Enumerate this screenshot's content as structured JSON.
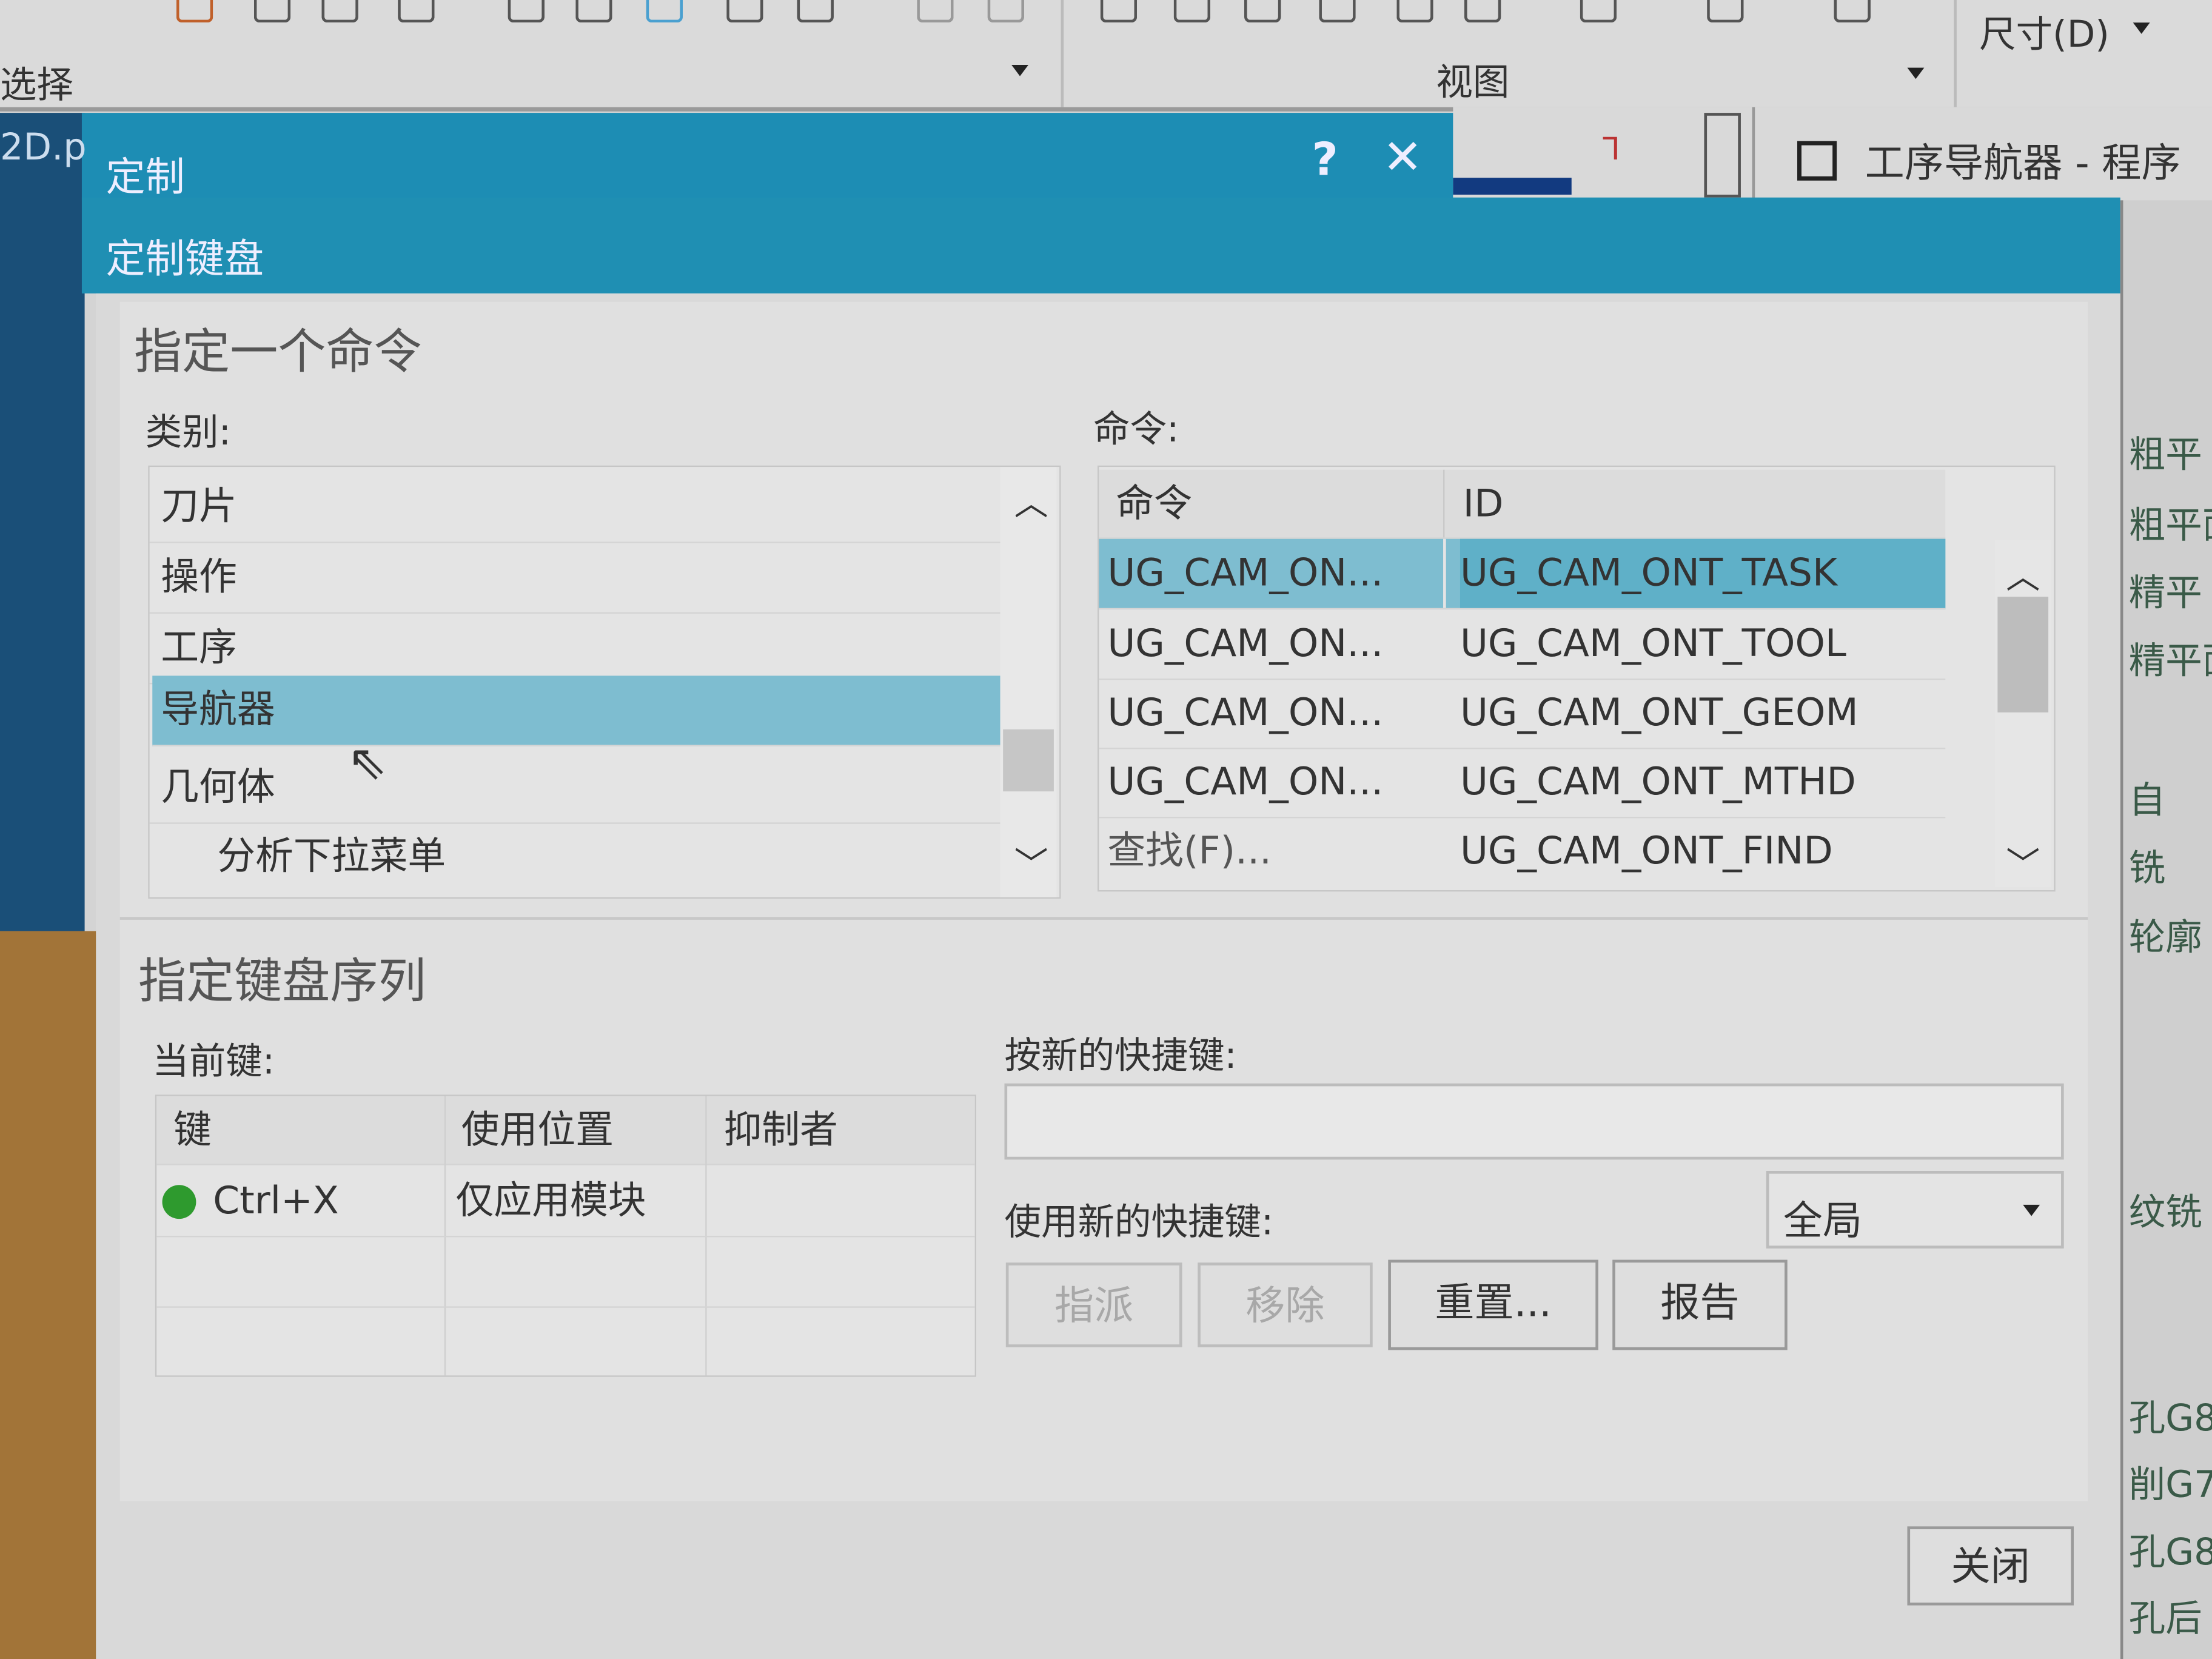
{
  "toolbar": {
    "select_label": "选择",
    "view_label": "视图",
    "dimension_label": "尺寸(D)"
  },
  "background": {
    "left_tab_fragment": "2D.p",
    "navigator_title": "工序导航器 - 程序",
    "right_list": [
      "粗平",
      "粗平面",
      "精平",
      "精平面",
      "自",
      "铣",
      "轮廓",
      "纹铣",
      "孔G8",
      "削G7",
      "孔G8",
      "孔后"
    ]
  },
  "dialog": {
    "title": "定制",
    "help_label": "?",
    "close_label": "✕",
    "banner": "定制键盘",
    "command_section": {
      "title": "指定一个命令",
      "category_label": "类别:",
      "categories": [
        "刀片",
        "操作",
        "工序",
        "导航器",
        "几何体",
        "分析下拉菜单"
      ],
      "selected_category": "导航器",
      "command_label": "命令:",
      "columns": [
        "命令",
        "ID"
      ],
      "rows": [
        [
          "UG_CAM_ON...",
          "UG_CAM_ONT_TASK"
        ],
        [
          "UG_CAM_ON...",
          "UG_CAM_ONT_TOOL"
        ],
        [
          "UG_CAM_ON...",
          "UG_CAM_ONT_GEOM"
        ],
        [
          "UG_CAM_ON...",
          "UG_CAM_ONT_MTHD"
        ],
        [
          "查找(F)...",
          "UG_CAM_ONT_FIND"
        ]
      ]
    },
    "key_section": {
      "title": "指定键盘序列",
      "current_keys_label": "当前键:",
      "columns": [
        "键",
        "使用位置",
        "抑制者"
      ],
      "rows": [
        [
          "Ctrl+X",
          "仅应用模块",
          ""
        ]
      ],
      "new_shortcut_label": "按新的快捷键:",
      "new_shortcut_value": "",
      "use_shortcut_label": "使用新的快捷键:",
      "scope_value": "全局",
      "buttons": {
        "assign": "指派",
        "remove": "移除",
        "reset": "重置...",
        "report": "报告"
      }
    },
    "close_button": "关闭",
    "colors": {
      "titlebar": "#1d8db4",
      "selection": "#7ebdd0",
      "status_dot": "#2e9a2e"
    }
  }
}
